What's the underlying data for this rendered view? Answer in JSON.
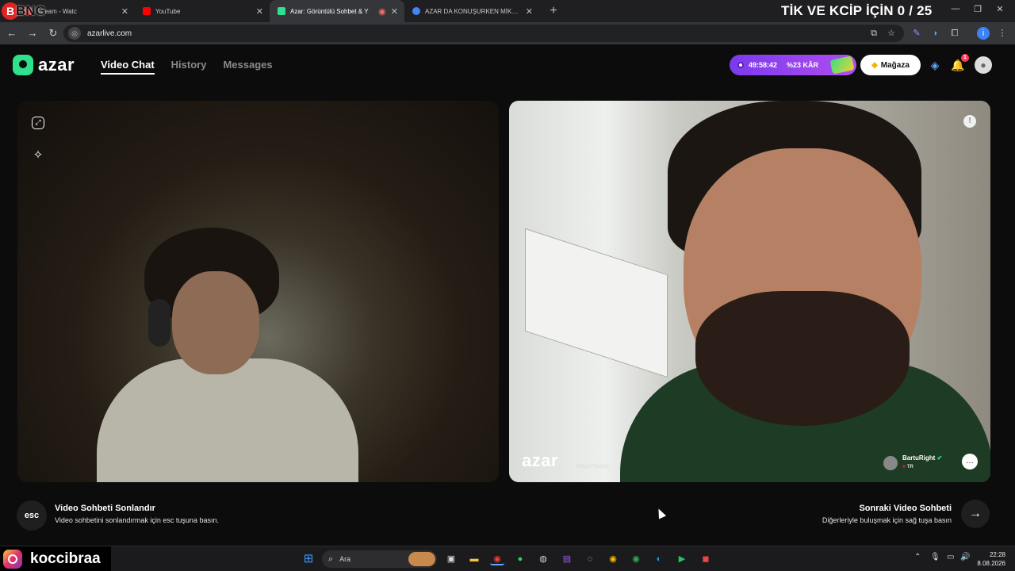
{
  "overlay": {
    "title": "TİK VE KCİP İÇİN 0 / 25",
    "stream_logo_text": "BNG"
  },
  "browser": {
    "tabs": [
      {
        "title": "Stream - Watc",
        "color": "#e63946"
      },
      {
        "title": "YouTube",
        "color": "#ff0000"
      },
      {
        "title": "Azar: Görüntülü Sohbet & Y",
        "color": "#2fe08d"
      },
      {
        "title": "AZAR DA KONUŞURKEN MİKRO",
        "color": "#4285f4"
      }
    ],
    "url": "azarlive.com",
    "new_tab": "+"
  },
  "azar": {
    "brand": "azar",
    "nav": [
      "Video Chat",
      "History",
      "Messages"
    ],
    "timer": "49:58:42",
    "discount": "%23 KÂR",
    "shop": "Mağaza",
    "notif_count": "1"
  },
  "peer": {
    "name": "BartuRight",
    "country": "TR",
    "watermark": "azar",
    "watermark_id": "hN6ynYSWQM"
  },
  "bottom": {
    "esc_key": "esc",
    "end_title": "Video Sohbeti Sonlandır",
    "end_sub": "Video sohbetini sonlandırmak için esc tuşuna basın.",
    "next_title": "Sonraki Video Sohbeti",
    "next_sub": "Diğerleriyle buluşmak için sağ tuşa basın"
  },
  "taskbar": {
    "handle": "koccibraa",
    "search": "Ara",
    "time": "22:28",
    "date": "8.08.2026"
  }
}
